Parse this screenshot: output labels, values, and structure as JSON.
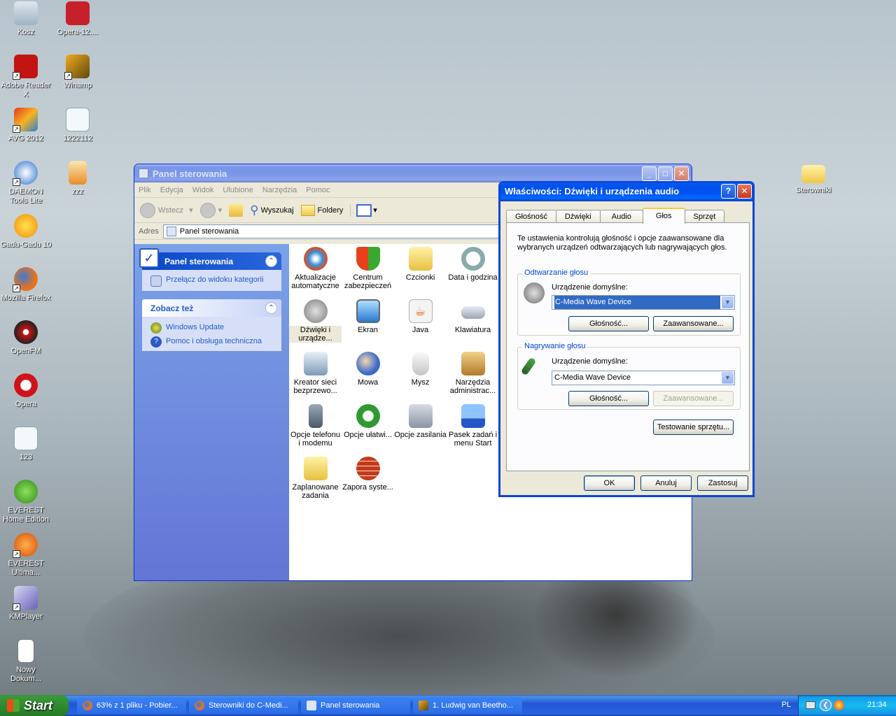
{
  "desktop": {
    "icons": [
      {
        "label": "Kosz"
      },
      {
        "label": "Opera-12...."
      },
      {
        "label": "Adobe Reader X"
      },
      {
        "label": "Winamp"
      },
      {
        "label": "AVG 2012"
      },
      {
        "label": "1222112"
      },
      {
        "label": "DAEMON Tools Lite"
      },
      {
        "label": "zzz"
      },
      {
        "label": "Gadu-Gadu 10"
      },
      {
        "label": "Mozilla Firefox"
      },
      {
        "label": "OpenFM"
      },
      {
        "label": "Opera"
      },
      {
        "label": "123"
      },
      {
        "label": "EVEREST Home Edition"
      },
      {
        "label": "EVEREST Ultima..."
      },
      {
        "label": "KMPlayer"
      },
      {
        "label": "Nowy Dokum..."
      },
      {
        "label": "Sterowniki"
      }
    ]
  },
  "control_panel": {
    "title": "Panel sterowania",
    "menu": [
      "Plik",
      "Edycja",
      "Widok",
      "Ulubione",
      "Narzędzia",
      "Pomoc"
    ],
    "toolbar": {
      "back": "Wstecz",
      "search": "Wyszukaj",
      "folders": "Foldery"
    },
    "address_label": "Adres",
    "address_value": "Panel sterowania",
    "task_pane": {
      "box1_title": "Panel sterowania",
      "box1_item": "Przełącz do widoku kategorii",
      "box2_title": "Zobacz też",
      "box2_items": [
        "Windows Update",
        "Pomoc i obsługa techniczna"
      ]
    },
    "items": [
      "Aktualizacje automatyczne",
      "Centrum zabezpieczeń",
      "Czcionki",
      "Data i godzina",
      "Dźwięki i urządze...",
      "Ekran",
      "Java",
      "Klawiatura",
      "Kreator sieci bezprzewo...",
      "Mowa",
      "Mysz",
      "Narzędzia administrac...",
      "Opcje telefonu i modemu",
      "Opcje ułatwi...",
      "Opcje zasilania",
      "Pasek zadań i menu Start",
      "Zaplanowane zadania",
      "Zapora syste..."
    ]
  },
  "dialog": {
    "title": "Właściwości: Dźwięki i urządzenia audio",
    "tabs": [
      "Głośność",
      "Dźwięki",
      "Audio",
      "Głos",
      "Sprzęt"
    ],
    "active_tab": "Głos",
    "description": "Te ustawienia kontrolują głośność i opcje zaawansowane dla wybranych urządzeń odtwarzających lub nagrywających głos.",
    "playback": {
      "group": "Odtwarzanie głosu",
      "label": "Urządzenie domyślne:",
      "device": "C-Media Wave Device",
      "volume_btn": "Głośność...",
      "advanced_btn": "Zaawansowane..."
    },
    "recording": {
      "group": "Nagrywanie głosu",
      "label": "Urządzenie domyślne:",
      "device": "C-Media Wave Device",
      "volume_btn": "Głośność...",
      "advanced_btn": "Zaawansowane..."
    },
    "test_btn": "Testowanie sprzętu...",
    "ok": "OK",
    "cancel": "Anuluj",
    "apply": "Zastosuj"
  },
  "taskbar": {
    "start": "Start",
    "buttons": [
      "63% z 1 pliku - Pobier...",
      "Sterowniki do C-Medi...",
      "Panel sterowania",
      "1. Ludwig van Beetho..."
    ],
    "lang": "PL",
    "clock": "21:34"
  }
}
